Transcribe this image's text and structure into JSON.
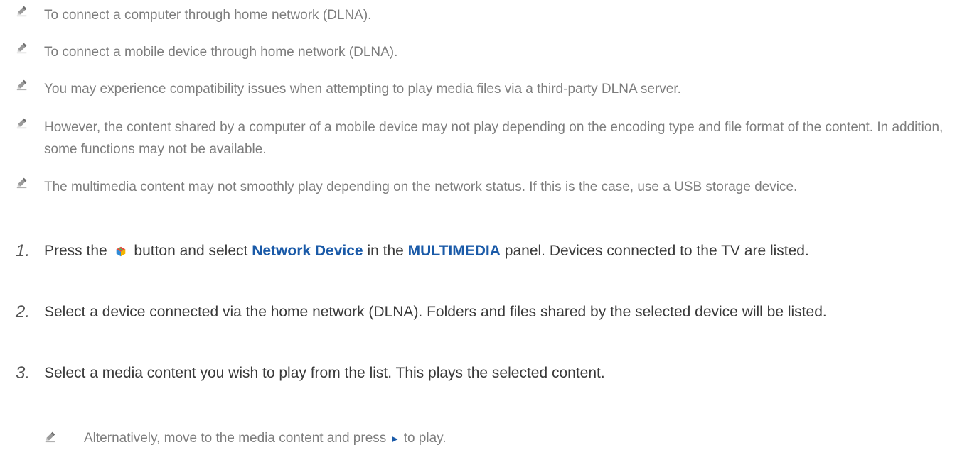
{
  "notes": [
    {
      "text": "To connect a computer through home network (DLNA)."
    },
    {
      "text": "To connect a mobile device through home network (DLNA)."
    },
    {
      "text": "You may experience compatibility issues when attempting to play media files via a third-party DLNA server."
    },
    {
      "text": "However, the content shared by a computer of a mobile device may not play depending on the encoding type and file format of the content. In addition, some functions may not be available."
    },
    {
      "text": "The multimedia content may not smoothly play depending on the network status. If this is the case, use a USB storage device."
    }
  ],
  "steps": [
    {
      "num": "1.",
      "pre": "Press the",
      "icon": "smart-hub-icon",
      "mid1": "button and select",
      "hl1": "Network Device",
      "mid2": "in the",
      "hl2": "MULTIMEDIA",
      "post": "panel. Devices connected to the TV are listed."
    },
    {
      "num": "2.",
      "text": "Select a device connected via the home network (DLNA). Folders and files shared by the selected device will be listed."
    },
    {
      "num": "3.",
      "text": "Select a media content you wish to play from the list. This plays the selected content."
    }
  ],
  "sub_note": {
    "pre": "Alternatively, move to the media content and press",
    "icon": "play-icon",
    "post": "to play."
  }
}
